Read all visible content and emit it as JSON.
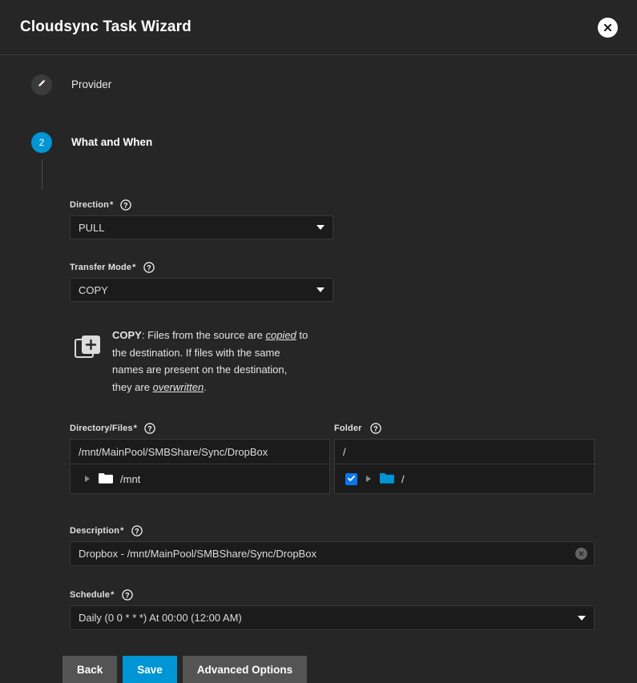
{
  "header": {
    "title": "Cloudsync Task Wizard",
    "close_icon": "close-icon"
  },
  "stepper": {
    "steps": [
      {
        "label": "Provider",
        "badge": "pencil-icon",
        "state": "done"
      },
      {
        "label": "What and When",
        "badge": "2",
        "state": "active"
      }
    ]
  },
  "form": {
    "direction": {
      "label": "Direction",
      "required": "*",
      "help_icon": "help-icon",
      "value": "PULL"
    },
    "transfer_mode": {
      "label": "Transfer Mode",
      "required": "*",
      "help_icon": "help-icon",
      "value": "COPY"
    },
    "transfer_mode_info": {
      "icon": "copy-icon",
      "mode": "COPY",
      "text_1": ": Files from the source are ",
      "em_1": "copied",
      "text_2": " to the destination. If files with the same names are present on the destination, they are ",
      "em_2": "overwritten",
      "text_3": "."
    },
    "directory_files": {
      "label": "Directory/Files",
      "required": "*",
      "help_icon": "help-icon",
      "value": "/mnt/MainPool/SMBShare/Sync/DropBox",
      "tree_node": {
        "label": "/mnt",
        "expander_icon": "chevron-right-icon",
        "folder_icon": "folder-icon"
      }
    },
    "folder": {
      "label": "Folder",
      "required": "",
      "help_icon": "help-icon",
      "value": "/",
      "tree_node": {
        "label": "/",
        "checked": true,
        "check_icon": "check-icon",
        "expander_icon": "chevron-right-icon",
        "folder_icon": "folder-icon"
      }
    },
    "description": {
      "label": "Description",
      "required": "*",
      "help_icon": "help-icon",
      "value": "Dropbox - /mnt/MainPool/SMBShare/Sync/DropBox",
      "clear_icon": "clear-icon"
    },
    "schedule": {
      "label": "Schedule",
      "required": "*",
      "help_icon": "help-icon",
      "value": "Daily (0 0 * * *)  At 00:00 (12:00 AM)"
    }
  },
  "actions": {
    "back": "Back",
    "save": "Save",
    "advanced": "Advanced Options"
  },
  "colors": {
    "accent": "#0095d5",
    "checkbox": "#0b76ef",
    "folder_selected": "#0095d5",
    "background": "#262626",
    "field_background": "#1b1b1b"
  }
}
